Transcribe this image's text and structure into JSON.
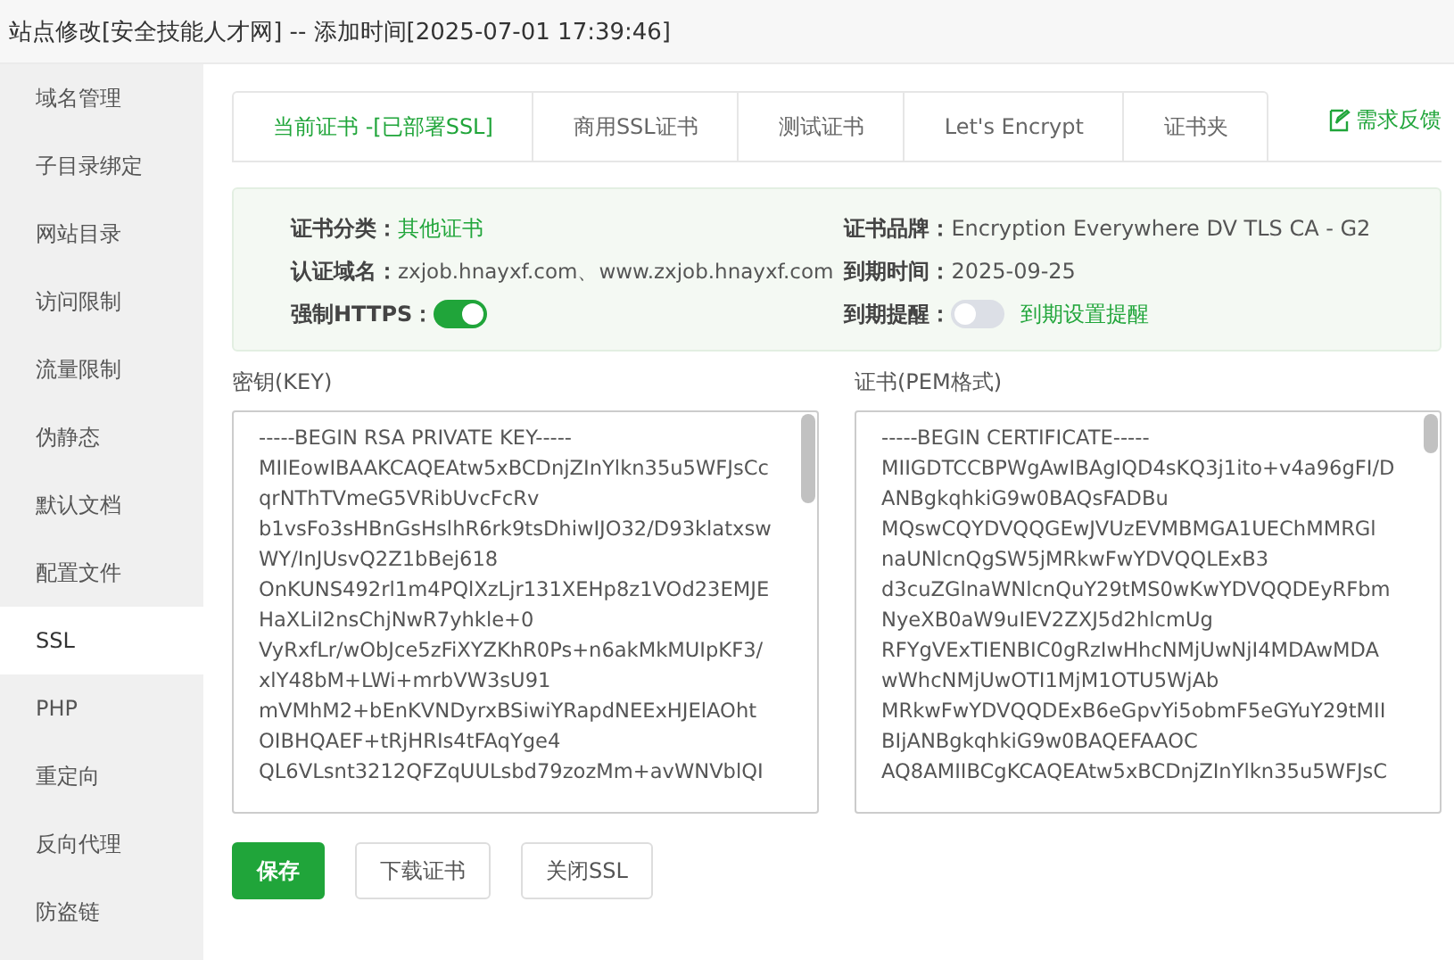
{
  "window": {
    "title": "站点修改[安全技能人才网] -- 添加时间[2025-07-01 17:39:46]"
  },
  "sidebar": {
    "items": [
      {
        "label": "域名管理",
        "selected": false
      },
      {
        "label": "子目录绑定",
        "selected": false
      },
      {
        "label": "网站目录",
        "selected": false
      },
      {
        "label": "访问限制",
        "selected": false
      },
      {
        "label": "流量限制",
        "selected": false
      },
      {
        "label": "伪静态",
        "selected": false
      },
      {
        "label": "默认文档",
        "selected": false
      },
      {
        "label": "配置文件",
        "selected": false
      },
      {
        "label": "SSL",
        "selected": true
      },
      {
        "label": "PHP",
        "selected": false
      },
      {
        "label": "重定向",
        "selected": false
      },
      {
        "label": "反向代理",
        "selected": false
      },
      {
        "label": "防盗链",
        "selected": false
      }
    ]
  },
  "tabs": [
    {
      "label": "当前证书 -[已部署SSL]",
      "selected": true
    },
    {
      "label": "商用SSL证书",
      "selected": false
    },
    {
      "label": "测试证书",
      "selected": false
    },
    {
      "label": "Let's Encrypt",
      "selected": false
    },
    {
      "label": "证书夹",
      "selected": false
    }
  ],
  "feedback_link": "需求反馈",
  "info": {
    "category_label": "证书分类：",
    "category": "其他证书",
    "domain_label": "认证域名：",
    "domain": "zxjob.hnayxf.com、www.zxjob.hnayxf.com",
    "https_label": "强制HTTPS：",
    "force_https": true,
    "brand_label": "证书品牌：",
    "brand": "Encryption Everywhere DV TLS CA - G2",
    "expiry_label": "到期时间：",
    "expiry": "2025-09-25",
    "reminder_label": "到期提醒：",
    "reminder": false,
    "reminder_link": "到期设置提醒"
  },
  "key": {
    "label": "密钥(KEY)",
    "lines": [
      "-----BEGIN RSA PRIVATE KEY-----",
      "MIIEowIBAAKCAQEAtw5xBCDnjZInYlkn35u5WFJsCc",
      "qrNThTVmeG5VRibUvcFcRv",
      "b1vsFo3sHBnGsHslhR6rk9tsDhiwIJO32/D93klatxsw",
      "WY/InJUsvQ2Z1bBej618",
      "OnKUNS492rl1m4PQlXzLjr131XEHp8z1VOd23EMJE",
      "HaXLiI2nsChjNwR7yhkle+0",
      "VyRxfLr/wObJce5zFiXYZKhR0Ps+n6akMkMUIpKF3/",
      "xlY48bM+LWi+mrbVW3sU91",
      "mVMhM2+bEnKVNDyrxBSiwiYRapdNEExHJElAOht",
      "OIBHQAEF+tRjHRIs4tFAqYge4",
      "QL6VLsnt3212QFZqUULsbd79zozMm+avWNVblQI"
    ]
  },
  "certificate": {
    "label": "证书(PEM格式)",
    "lines": [
      "-----BEGIN CERTIFICATE-----",
      "MIIGDTCCBPWgAwIBAgIQD4sKQ3j1ito+v4a96gFI/D",
      "ANBgkqhkiG9w0BAQsFADBu",
      "MQswCQYDVQQGEwJVUzEVMBMGA1UEChMMRGl",
      "naUNlcnQgSW5jMRkwFwYDVQQLExB3",
      "d3cuZGlnaWNlcnQuY29tMS0wKwYDVQQDEyRFbm",
      "NyeXB0aW9uIEV2ZXJ5d2hlcmUg",
      "RFYgVExTIENBIC0gRzIwHhcNMjUwNjI4MDAwMDA",
      "wWhcNMjUwOTI1MjM1OTU5WjAb",
      "MRkwFwYDVQQDExB6eGpvYi5obmF5eGYuY29tMII",
      "BIjANBgkqhkiG9w0BAQEFAAOC",
      "AQ8AMIIBCgKCAQEAtw5xBCDnjZInYlkn35u5WFJsC"
    ]
  },
  "buttons": [
    {
      "label": "保存",
      "kind": "primary"
    },
    {
      "label": "下载证书",
      "kind": "default"
    },
    {
      "label": "关闭SSL",
      "kind": "default"
    }
  ]
}
